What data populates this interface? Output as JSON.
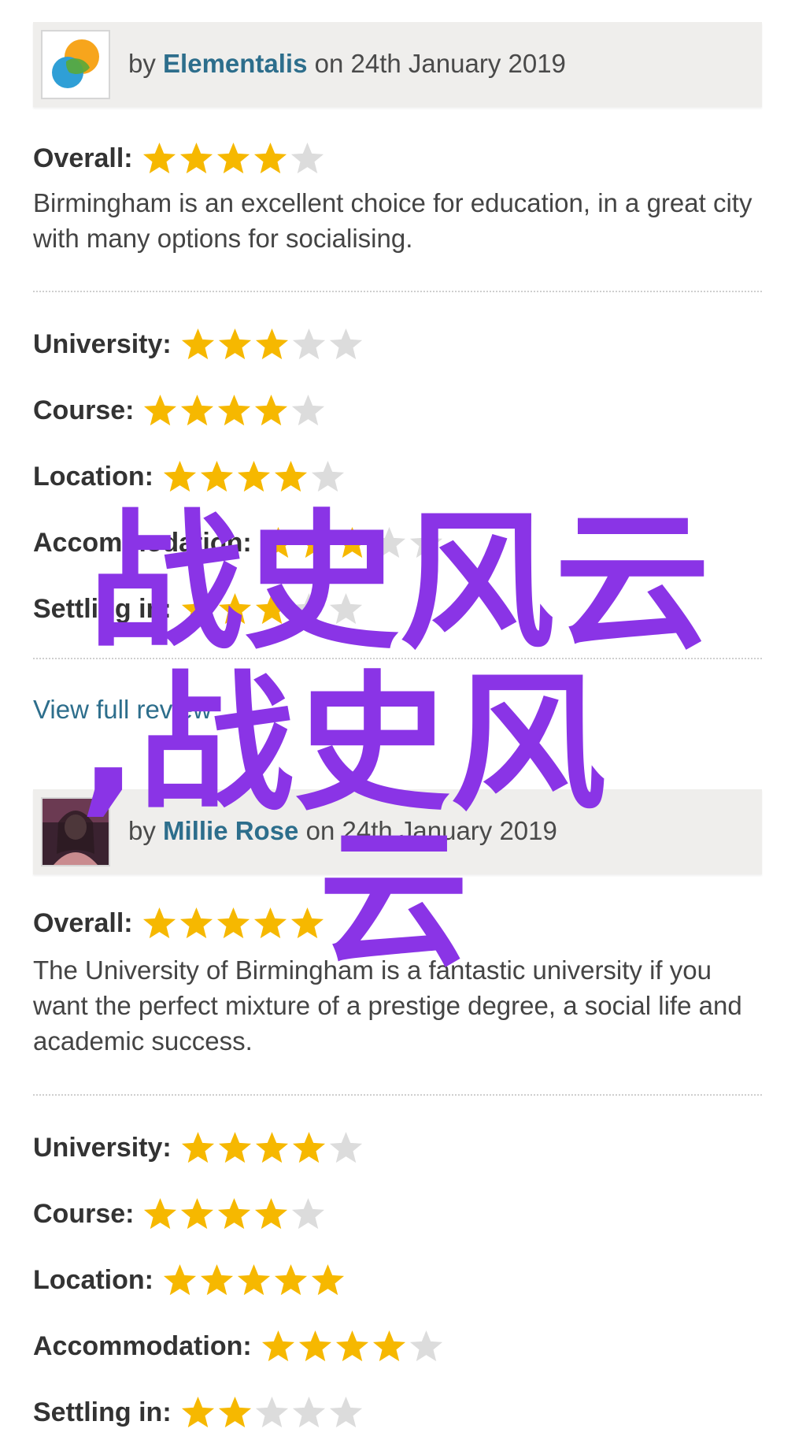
{
  "colors": {
    "star_on": "#f6b800",
    "star_off": "#dcdcdc",
    "link": "#2d6e8c",
    "header_bg": "#efeeec",
    "watermark": "#8a34e6"
  },
  "reviews": [
    {
      "by": "by",
      "author": "Elementalis",
      "on": "on",
      "date": "24th January 2019",
      "avatar_icon": "colored-circles-logo-icon",
      "overall_label": "Overall:",
      "overall_stars": 4,
      "text": "Birmingham is an excellent choice for education, in a great city with many options for socialising.",
      "ratings": [
        {
          "label": "University:",
          "stars": 3
        },
        {
          "label": "Course:",
          "stars": 4
        },
        {
          "label": "Location:",
          "stars": 4
        },
        {
          "label": "Accommodation:",
          "stars": 3
        },
        {
          "label": "Settling in:",
          "stars": 3
        }
      ],
      "link": "View full review"
    },
    {
      "by": "by",
      "author": "Millie Rose",
      "on": "on",
      "date": "24th January 2019",
      "avatar_icon": "user-photo-avatar-icon",
      "overall_label": "Overall:",
      "overall_stars": 5,
      "text": "The University of Birmingham is a fantastic university if you want the perfect mixture of a prestige degree, a social life and academic success.",
      "ratings": [
        {
          "label": "University:",
          "stars": 4
        },
        {
          "label": "Course:",
          "stars": 4
        },
        {
          "label": "Location:",
          "stars": 5
        },
        {
          "label": "Accommodation:",
          "stars": 4
        },
        {
          "label": "Settling in:",
          "stars": 2
        }
      ]
    }
  ],
  "watermark": {
    "line1": "战史风云",
    "line2": ",战史风",
    "line3": "云"
  }
}
